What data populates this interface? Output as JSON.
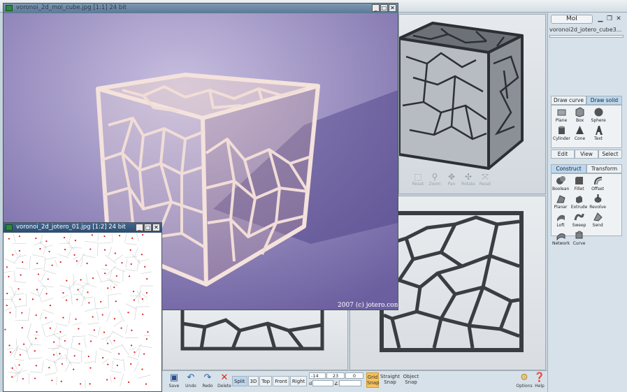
{
  "main_viewer": {
    "title": "voronoi_2d_moi_cube.jpg [1:1] 24 bit",
    "watermark": "2007 (c) jotero.com"
  },
  "small_viewer": {
    "title": "voronoi_2d_jotero_01.jpg [1:2] 24 bit"
  },
  "panel": {
    "moi_label": "MoI",
    "file_name": "voronoi2d_jotero_cube3...",
    "draw_tabs": [
      "Draw curve",
      "Draw solid"
    ],
    "draw_tools": [
      "Plane",
      "Box",
      "Sphere",
      "Cylinder",
      "Cone",
      "Text"
    ],
    "edit_tabs": [
      "Edit",
      "View",
      "Select"
    ],
    "construct_tabs": [
      "Construct",
      "Transform"
    ],
    "construct_tools": [
      "Boolean",
      "Fillet",
      "Offset",
      "Planar",
      "Extrude",
      "Revolve",
      "Loft",
      "Sweep",
      "Send",
      "Network",
      "Curve"
    ]
  },
  "nav_tools": [
    "Reset",
    "Zoom",
    "Pan",
    "Rotate",
    "Reset"
  ],
  "bottom_bar": {
    "file_buttons": [
      "Save",
      "Undo",
      "Redo",
      "Delete"
    ],
    "views": [
      "Split",
      "3D",
      "Top",
      "Front",
      "Right"
    ],
    "active_view": "Split",
    "coords": [
      "-14",
      "23",
      "0"
    ],
    "d_label": "d",
    "angle_label": "∠",
    "snaps": [
      {
        "line1": "Grid",
        "line2": "Snap"
      },
      {
        "line1": "Straight",
        "line2": "Snap"
      },
      {
        "line1": "Object",
        "line2": "Snap"
      }
    ],
    "options_label": "Options",
    "help_label": "Help"
  },
  "colors": {
    "accent_tab": "#bcd8f0",
    "grid_snap": "#f6c25a",
    "dot_red": "#d81e1e"
  }
}
